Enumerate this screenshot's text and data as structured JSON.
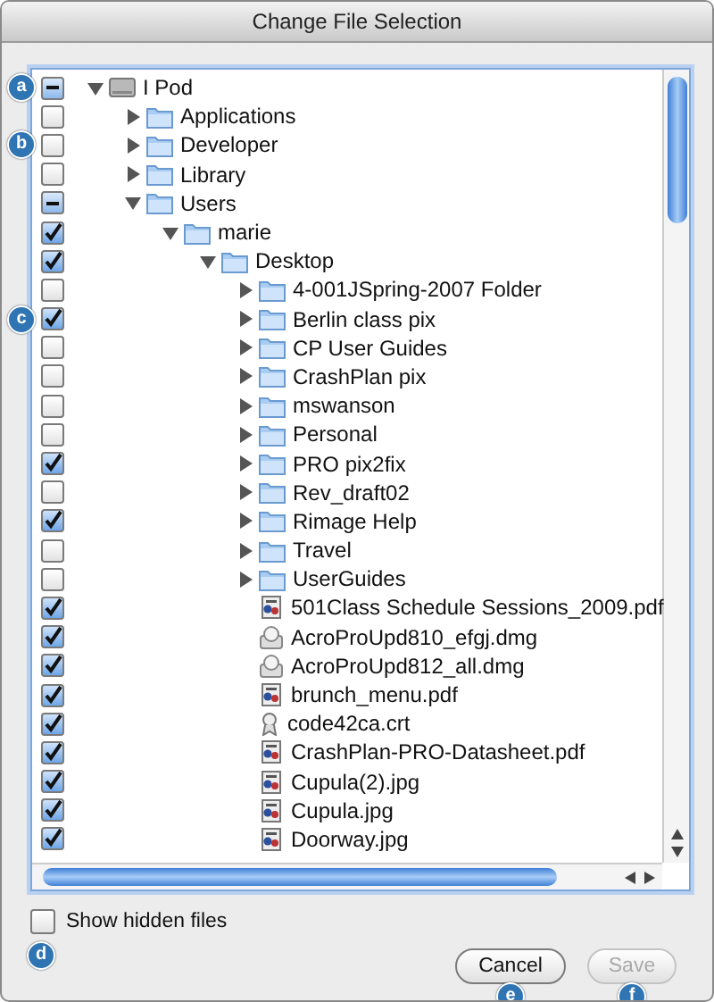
{
  "window": {
    "title": "Change File Selection"
  },
  "tree": [
    {
      "label": "I Pod",
      "kind": "drive",
      "mixed": true,
      "expanded": true,
      "callout": "a",
      "children": [
        {
          "label": "Applications",
          "kind": "folder",
          "checked": false,
          "expanded": false
        },
        {
          "label": "Developer",
          "kind": "folder",
          "checked": false,
          "expanded": false,
          "callout": "b"
        },
        {
          "label": "Library",
          "kind": "folder",
          "checked": false,
          "expanded": false
        },
        {
          "label": "Users",
          "kind": "folder",
          "mixed": true,
          "expanded": true,
          "children": [
            {
              "label": "marie",
              "kind": "folder",
              "checked": true,
              "expanded": true,
              "children": [
                {
                  "label": "Desktop",
                  "kind": "folder",
                  "checked": true,
                  "expanded": true,
                  "children": [
                    {
                      "label": "4-001JSpring-2007 Folder",
                      "kind": "folder",
                      "checked": false,
                      "expanded": false
                    },
                    {
                      "label": "Berlin class pix",
                      "kind": "folder",
                      "checked": true,
                      "expanded": false,
                      "callout": "c"
                    },
                    {
                      "label": "CP User Guides",
                      "kind": "folder",
                      "checked": false,
                      "expanded": false
                    },
                    {
                      "label": "CrashPlan pix",
                      "kind": "folder",
                      "checked": false,
                      "expanded": false
                    },
                    {
                      "label": "mswanson",
                      "kind": "folder",
                      "checked": false,
                      "expanded": false
                    },
                    {
                      "label": "Personal",
                      "kind": "folder",
                      "checked": false,
                      "expanded": false
                    },
                    {
                      "label": "PRO pix2fix",
                      "kind": "folder",
                      "checked": true,
                      "expanded": false
                    },
                    {
                      "label": "Rev_draft02",
                      "kind": "folder",
                      "checked": false,
                      "expanded": false
                    },
                    {
                      "label": "Rimage Help",
                      "kind": "folder",
                      "checked": true,
                      "expanded": false
                    },
                    {
                      "label": "Travel",
                      "kind": "folder",
                      "checked": false,
                      "expanded": false
                    },
                    {
                      "label": "UserGuides",
                      "kind": "folder",
                      "checked": false,
                      "expanded": false
                    },
                    {
                      "label": "501Class Schedule Sessions_2009.pdf",
                      "kind": "document",
                      "checked": true
                    },
                    {
                      "label": "AcroProUpd810_efgj.dmg",
                      "kind": "disk-image",
                      "checked": true
                    },
                    {
                      "label": "AcroProUpd812_all.dmg",
                      "kind": "disk-image",
                      "checked": true
                    },
                    {
                      "label": "brunch_menu.pdf",
                      "kind": "document",
                      "checked": true
                    },
                    {
                      "label": "code42ca.crt",
                      "kind": "certificate",
                      "checked": true
                    },
                    {
                      "label": "CrashPlan-PRO-Datasheet.pdf",
                      "kind": "document",
                      "checked": true
                    },
                    {
                      "label": "Cupula(2).jpg",
                      "kind": "document",
                      "checked": true
                    },
                    {
                      "label": "Cupula.jpg",
                      "kind": "document",
                      "checked": true
                    },
                    {
                      "label": "Doorway.jpg",
                      "kind": "document",
                      "checked": true
                    }
                  ]
                }
              ]
            }
          ]
        }
      ]
    }
  ],
  "show_hidden": {
    "label": "Show hidden files",
    "checked": false,
    "callout": "d"
  },
  "buttons": [
    {
      "label": "Cancel",
      "disabled": false,
      "callout": "e"
    },
    {
      "label": "Save",
      "disabled": true,
      "callout": "f"
    }
  ]
}
